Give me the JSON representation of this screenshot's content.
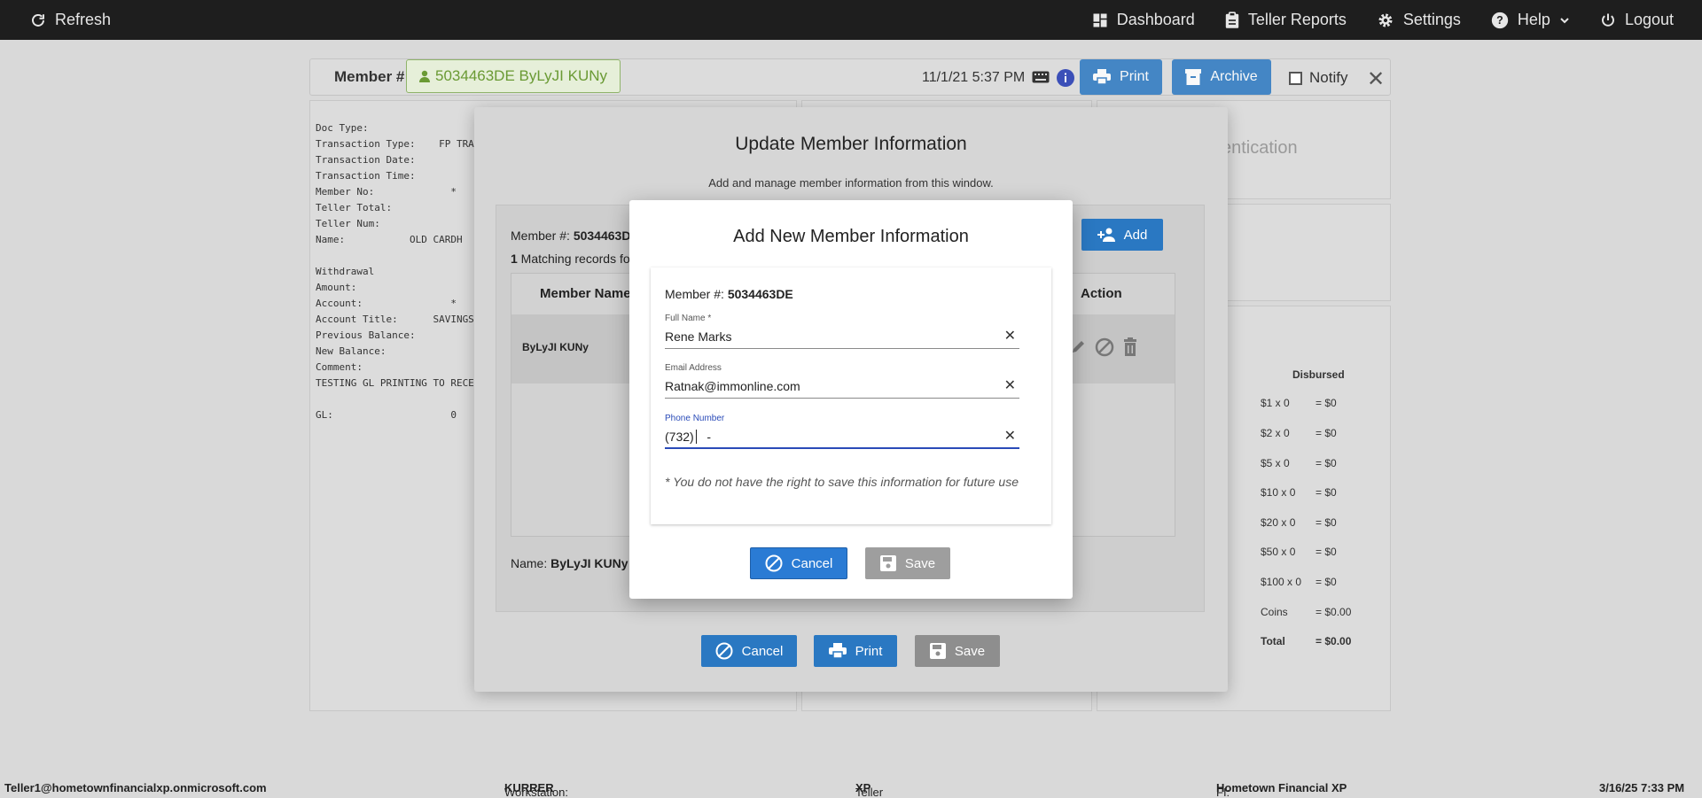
{
  "topbar": {
    "refresh_label": "Refresh",
    "nav": [
      {
        "label": "Dashboard",
        "icon": "dashboard-icon"
      },
      {
        "label": "Teller Reports",
        "icon": "clipboard-icon"
      },
      {
        "label": "Settings",
        "icon": "gear-icon"
      },
      {
        "label": "Help",
        "icon": "help-icon"
      },
      {
        "label": "Logout",
        "icon": "power-icon"
      }
    ]
  },
  "page": {
    "member_label": "Member #:",
    "member_chip": "5034463DE ByLyJI KUNy",
    "datetime": "11/1/21 5:37 PM",
    "print_label": "Print",
    "archive_label": "Archive",
    "notify_label": "Notify",
    "receipt": "Doc Type:\nTransaction Type:    FP TRA\nTransaction Date:\nTransaction Time:\nMember No:             *\nTeller Total:\nTeller Num:\nName:           OLD CARDH\n\nWithdrawal\nAmount:\nAccount:               *\nAccount Title:      SAVINGS\nPrevious Balance:\nNew Balance:\nComment:\nTESTING GL PRINTING TO RECE\n\nGL:                    0",
    "auth_text": "entication",
    "disbursed_header": "Disbursed",
    "disbursed_rows": [
      {
        "label": "$1 x 0",
        "value": "= $0"
      },
      {
        "label": "$2 x 0",
        "value": "= $0"
      },
      {
        "label": "$5 x 0",
        "value": "= $0"
      },
      {
        "label": "$10 x 0",
        "value": "= $0"
      },
      {
        "label": "$20 x 0",
        "value": "= $0"
      },
      {
        "label": "$50 x 0",
        "value": "= $0"
      },
      {
        "label": "$100 x 0",
        "value": "= $0"
      },
      {
        "label": "Coins",
        "value": "= $0.00"
      },
      {
        "label": "Total",
        "value": "= $0.00"
      }
    ]
  },
  "outer_modal": {
    "title": "Update Member Information",
    "subtitle": "Add and manage member information from this window.",
    "member_prefix": "Member #: ",
    "member_value": "5034463D",
    "count_number": "1",
    "count_text": " Matching records fo",
    "add_label": "Add",
    "col_member_name": "Member Name",
    "col_action": "Action",
    "row_name": "ByLyJI KUNy",
    "name_prefix": "Name: ",
    "name_value": "ByLyJI KUNy",
    "cancel_label": "Cancel",
    "print_label": "Print",
    "save_label": "Save"
  },
  "inner_modal": {
    "title": "Add New Member Information",
    "member_prefix": "Member #: ",
    "member_value": "5034463DE",
    "full_name_label": "Full Name *",
    "full_name_value": "Rene Marks",
    "email_label": "Email Address",
    "email_value": "Ratnak@immonline.com",
    "phone_label": "Phone Number",
    "phone_value_prefix": "(732)",
    "phone_value_suffix": "   -",
    "note": "* You do not have the right to save this information for future use",
    "cancel_label": "Cancel",
    "save_label": "Save"
  },
  "footer": {
    "user": "Teller1@hometownfinancialxp.onmicrosoft.com",
    "workstation_label": "Workstation: ",
    "workstation_value": "KURRER",
    "platform_label": "Teller Platform: ",
    "platform_value": "XP",
    "fi_label": "FI: ",
    "fi_value": "Hometown Financial XP",
    "datetime": "3/16/25 7:33 PM"
  }
}
